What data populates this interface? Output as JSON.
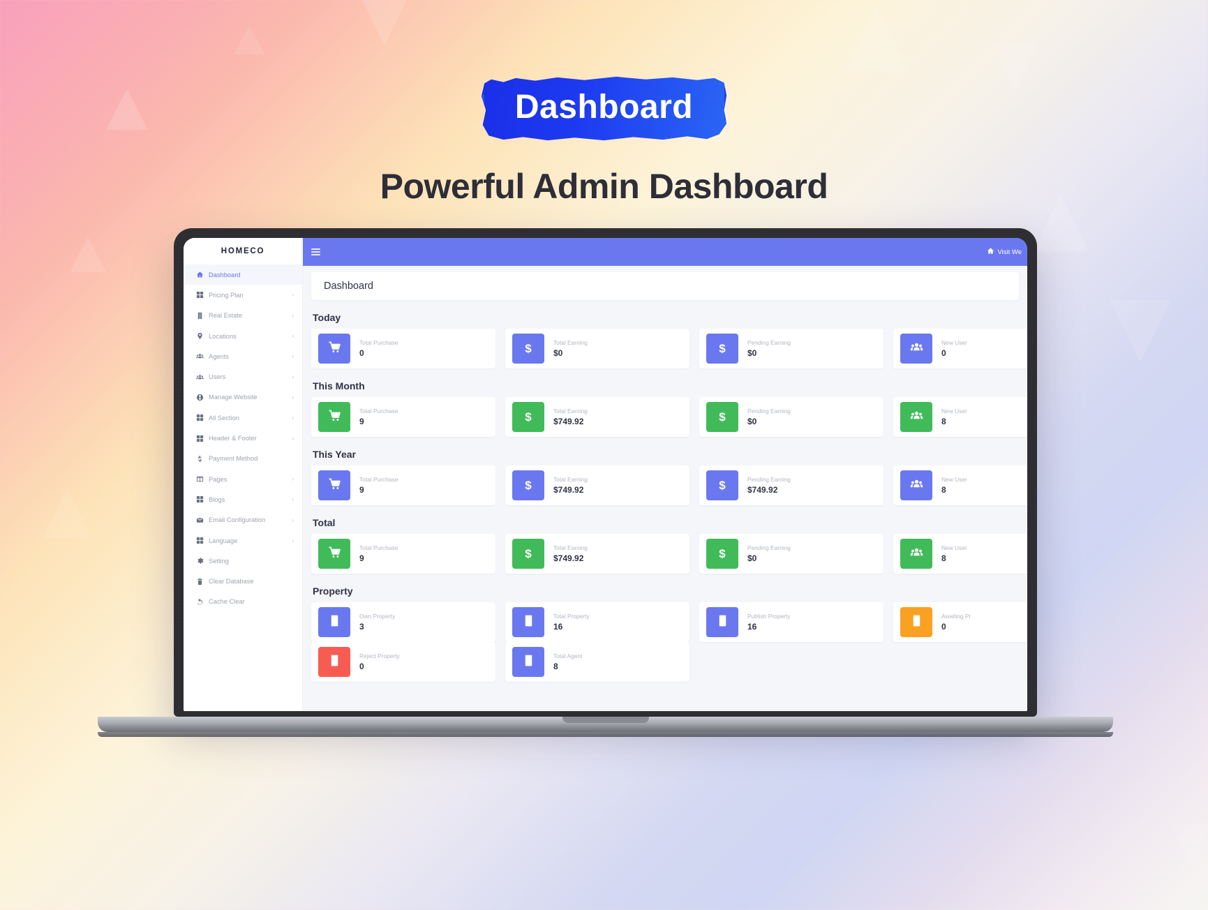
{
  "hero": {
    "badge": "Dashboard",
    "headline": "Powerful Admin Dashboard"
  },
  "app": {
    "brand": "HOMECO",
    "topbar": {
      "menu_icon": "hamburger-icon",
      "visit_site_label": "Visit We",
      "visit_site_icon": "home-icon",
      "accent": "#6a78ef"
    },
    "breadcrumb": {
      "title": "Dashboard"
    },
    "sidebar": {
      "items": [
        {
          "label": "Dashboard",
          "icon": "home-icon",
          "active": true,
          "caret": ""
        },
        {
          "label": "Pricing Plan",
          "icon": "grid-icon",
          "active": false,
          "caret": "›"
        },
        {
          "label": "Real Estate",
          "icon": "building-icon",
          "active": false,
          "caret": "›"
        },
        {
          "label": "Locations",
          "icon": "map-pin-icon",
          "active": false,
          "caret": "›"
        },
        {
          "label": "Agents",
          "icon": "users-icon",
          "active": false,
          "caret": "›"
        },
        {
          "label": "Users",
          "icon": "users-icon",
          "active": false,
          "caret": "›"
        },
        {
          "label": "Manage Website",
          "icon": "globe-icon",
          "active": false,
          "caret": "›"
        },
        {
          "label": "All Section",
          "icon": "grid-icon",
          "active": false,
          "caret": "›"
        },
        {
          "label": "Header & Footer",
          "icon": "grid-icon",
          "active": false,
          "caret": "›"
        },
        {
          "label": "Payment Method",
          "icon": "dollar-icon",
          "active": false,
          "caret": ""
        },
        {
          "label": "Pages",
          "icon": "columns-icon",
          "active": false,
          "caret": "›"
        },
        {
          "label": "Blogs",
          "icon": "grid-icon",
          "active": false,
          "caret": "›"
        },
        {
          "label": "Email Configuration",
          "icon": "envelope-icon",
          "active": false,
          "caret": "›"
        },
        {
          "label": "Language",
          "icon": "grid-icon",
          "active": false,
          "caret": "›"
        },
        {
          "label": "Setting",
          "icon": "gear-icon",
          "active": false,
          "caret": ""
        },
        {
          "label": "Clear Database",
          "icon": "trash-icon",
          "active": false,
          "caret": ""
        },
        {
          "label": "Cache Clear",
          "icon": "undo-icon",
          "active": false,
          "caret": ""
        }
      ]
    },
    "sections": [
      {
        "title": "Today",
        "cards": [
          {
            "label": "Total Purchase",
            "value": "0",
            "icon": "cart-icon",
            "color": "blue"
          },
          {
            "label": "Total Earning",
            "value": "$0",
            "icon": "dollar-icon",
            "color": "blue"
          },
          {
            "label": "Pending Earning",
            "value": "$0",
            "icon": "dollar-icon",
            "color": "blue"
          },
          {
            "label": "New User",
            "value": "0",
            "icon": "users-icon",
            "color": "blue"
          }
        ]
      },
      {
        "title": "This Month",
        "cards": [
          {
            "label": "Total Purchase",
            "value": "9",
            "icon": "cart-icon",
            "color": "green"
          },
          {
            "label": "Total Earning",
            "value": "$749.92",
            "icon": "dollar-icon",
            "color": "green"
          },
          {
            "label": "Pending Earning",
            "value": "$0",
            "icon": "dollar-icon",
            "color": "green"
          },
          {
            "label": "New User",
            "value": "8",
            "icon": "users-icon",
            "color": "green"
          }
        ]
      },
      {
        "title": "This Year",
        "cards": [
          {
            "label": "Total Purchase",
            "value": "9",
            "icon": "cart-icon",
            "color": "blue"
          },
          {
            "label": "Total Earning",
            "value": "$749.92",
            "icon": "dollar-icon",
            "color": "blue"
          },
          {
            "label": "Pending Earning",
            "value": "$749.92",
            "icon": "dollar-icon",
            "color": "blue"
          },
          {
            "label": "New User",
            "value": "8",
            "icon": "users-icon",
            "color": "blue"
          }
        ]
      },
      {
        "title": "Total",
        "cards": [
          {
            "label": "Total Purchase",
            "value": "9",
            "icon": "cart-icon",
            "color": "green"
          },
          {
            "label": "Total Earning",
            "value": "$749.92",
            "icon": "dollar-icon",
            "color": "green"
          },
          {
            "label": "Pending Earning",
            "value": "$0",
            "icon": "dollar-icon",
            "color": "green"
          },
          {
            "label": "New User",
            "value": "8",
            "icon": "users-icon",
            "color": "green"
          }
        ]
      },
      {
        "title": "Property",
        "cards": [
          {
            "label": "Own Property",
            "value": "3",
            "icon": "building-icon",
            "color": "blue"
          },
          {
            "label": "Total Property",
            "value": "16",
            "icon": "building-icon",
            "color": "blue"
          },
          {
            "label": "Publish Property",
            "value": "16",
            "icon": "building-icon",
            "color": "blue"
          },
          {
            "label": "Awaiting Pr",
            "value": "0",
            "icon": "building-icon",
            "color": "orange"
          }
        ]
      },
      {
        "title": "",
        "cards": [
          {
            "label": "Reject Property",
            "value": "0",
            "icon": "building-icon",
            "color": "red"
          },
          {
            "label": "Total Agent",
            "value": "8",
            "icon": "building-icon",
            "color": "blue"
          }
        ]
      }
    ],
    "colors": {
      "blue": "#6a78ef",
      "green": "#41bb59",
      "orange": "#faa121",
      "red": "#f75c52"
    }
  }
}
